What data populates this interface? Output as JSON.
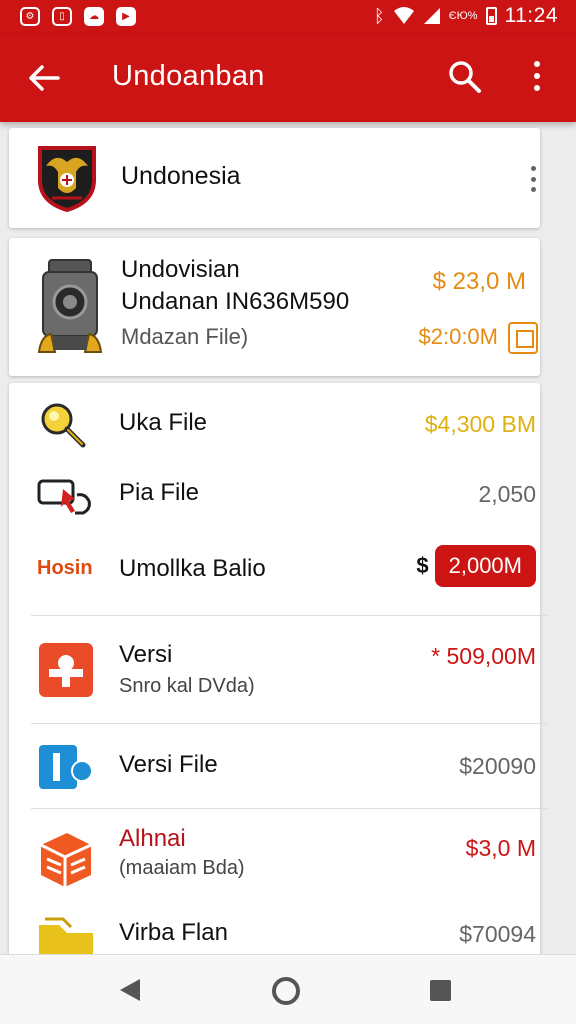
{
  "status_bar": {
    "time": "11:24",
    "carrier_text": "ЄЮ%"
  },
  "app_bar": {
    "title": "Undoanban"
  },
  "card1": {
    "title": "Undonesia"
  },
  "card2": {
    "line1": "Undovisian",
    "line2": "Undanan IN636M590",
    "line3": "Mdazan File)",
    "price": "$ 23,0 M",
    "price2": "$2:0:0M"
  },
  "list": {
    "rows": [
      {
        "label": "Uka File",
        "value": "$4,300 BM"
      },
      {
        "label": "Pia File",
        "value": "2,050"
      },
      {
        "tag": "Hosin",
        "label": "Umollka Balio",
        "currency": "$",
        "badge": "2,000M"
      },
      {
        "label": "Versi",
        "sub": "Snro kal DVda)",
        "value": "* 509,00M"
      },
      {
        "label": "Versi File",
        "value": "$20090"
      },
      {
        "label": "Alhnai",
        "sub": "(maaiam Bda)",
        "value": "$3,0 M"
      },
      {
        "label": "Virba Flan",
        "value": "$70094"
      }
    ]
  },
  "colors": {
    "brand": "#cc1414",
    "accent_orange": "#e68a12",
    "gold": "#e8b810"
  }
}
